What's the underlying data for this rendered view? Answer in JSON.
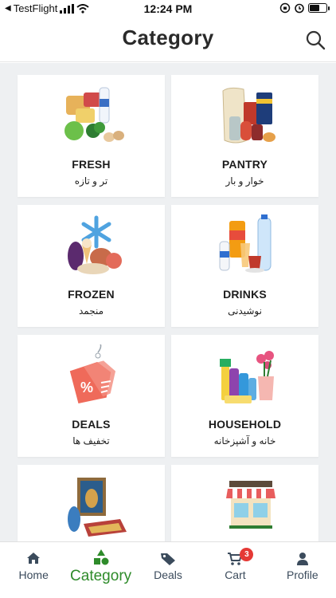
{
  "status_bar": {
    "back_app": "TestFlight",
    "time": "12:24 PM"
  },
  "header": {
    "title": "Category"
  },
  "categories": [
    {
      "en": "FRESH",
      "fa": "تر و تازه",
      "icon": "fresh-produce-icon"
    },
    {
      "en": "PANTRY",
      "fa": "خوار و بار",
      "icon": "pantry-goods-icon"
    },
    {
      "en": "FROZEN",
      "fa": "منجمد",
      "icon": "frozen-food-icon"
    },
    {
      "en": "DRINKS",
      "fa": "نوشیدنی",
      "icon": "drinks-icon"
    },
    {
      "en": "DEALS",
      "fa": "تخفیف ها",
      "icon": "discount-tag-icon"
    },
    {
      "en": "HOUSEHOLD",
      "fa": "خانه و آشپزخانه",
      "icon": "household-cleaning-icon"
    },
    {
      "en": "",
      "fa": "",
      "icon": "carpet-art-icon"
    },
    {
      "en": "",
      "fa": "",
      "icon": "storefront-icon"
    }
  ],
  "tabs": [
    {
      "label": "Home",
      "icon": "home-icon"
    },
    {
      "label": "Category",
      "icon": "shapes-icon",
      "active": true
    },
    {
      "label": "Deals",
      "icon": "tag-icon"
    },
    {
      "label": "Cart",
      "icon": "cart-icon",
      "badge": "3"
    },
    {
      "label": "Profile",
      "icon": "person-icon"
    }
  ],
  "colors": {
    "accent": "#2e8b2a",
    "badge": "#e53935",
    "background": "#eef0f2",
    "tab_text": "#3b4b5c"
  }
}
